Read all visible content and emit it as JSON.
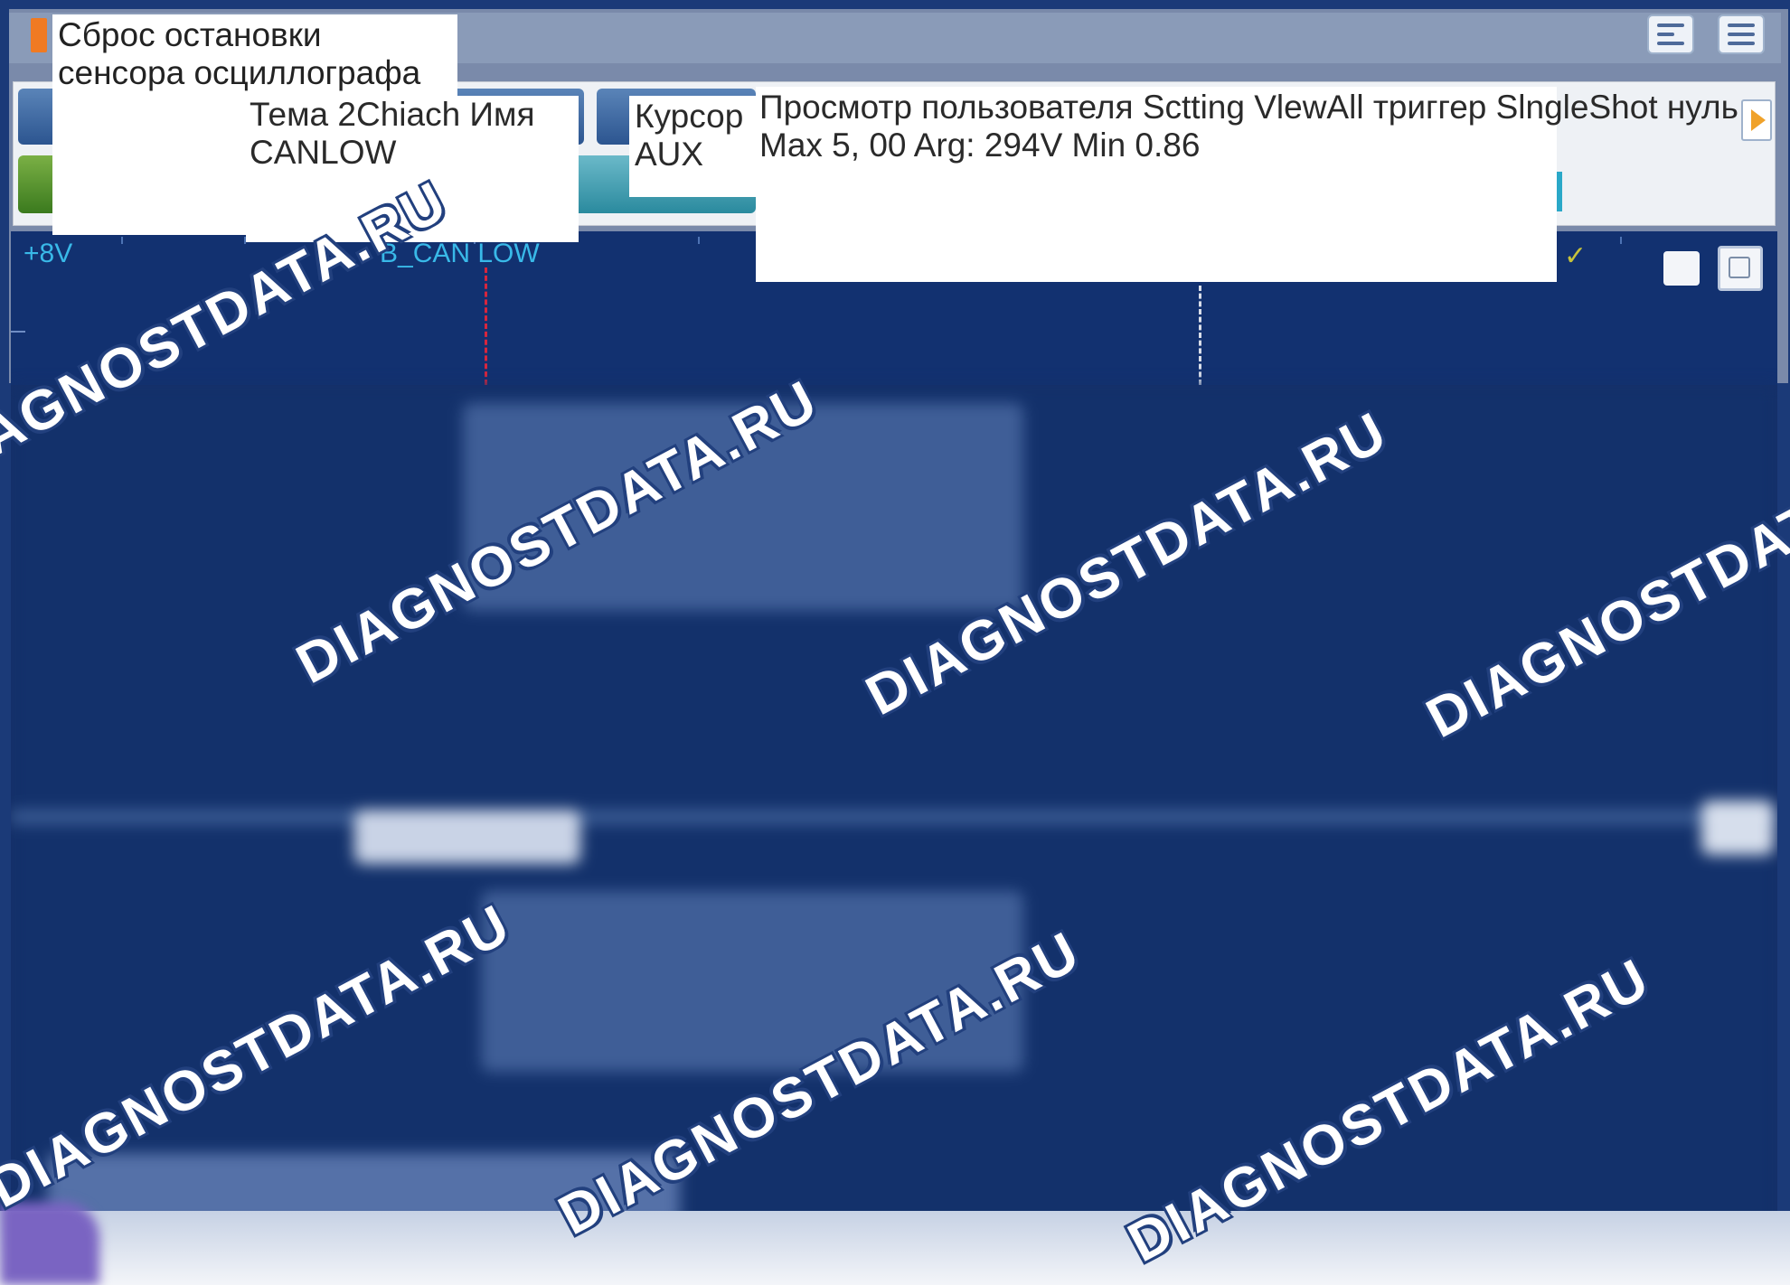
{
  "titlebar": {
    "title": "Сброс остановки сенсора осциллографа"
  },
  "popups": {
    "channel": "Тема 2Chiach Имя CANLOW",
    "cursor": "Курсор AUX",
    "status_line1": "Просмотр пользователя Sctting VlewAll триггер SlngleShot нуль",
    "status_line2": "Max 5, 00 Arg: 294V Min 0.86"
  },
  "scope": {
    "voltage_label": "+8V",
    "channel_label": "B_CAN LOW"
  },
  "watermark": "DIAGNOSTDATA.RU",
  "icons": {
    "window_buttons": [
      "window-icon",
      "menu-icon"
    ],
    "scope_buttons": [
      "square-icon",
      "window-frame-icon"
    ],
    "next": "arrow-right-icon",
    "trigger_check": "check-icon"
  },
  "colors": {
    "scope_bg": "#152f68",
    "label": "#39b9e8",
    "cursor_red": "#d7263d",
    "accent_orange": "#f07a22"
  }
}
